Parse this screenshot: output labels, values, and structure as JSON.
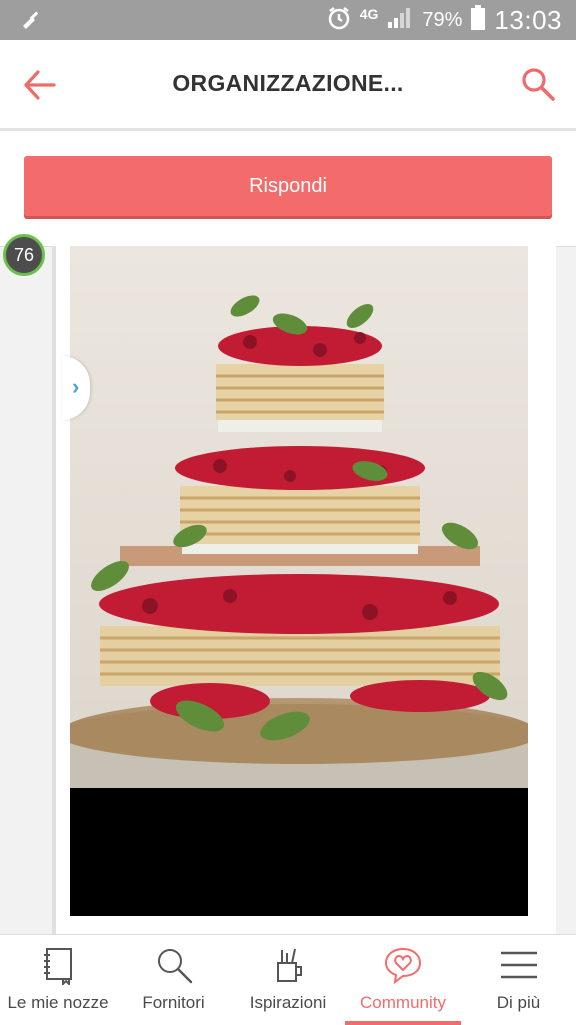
{
  "status_bar": {
    "network": "4G",
    "battery": "79%",
    "time": "13:03",
    "icons": [
      "cleaner-icon",
      "alarm-icon",
      "signal-icon",
      "battery-icon"
    ]
  },
  "app_bar": {
    "title": "ORGANIZZAZIONE...",
    "back_icon": "back-arrow-icon",
    "search_icon": "search-icon"
  },
  "reply_button": {
    "label": "Rispondi"
  },
  "post": {
    "score": "76",
    "image_desc_icon": "photo",
    "nav_arrow_icon": "chevron-right-icon"
  },
  "bottom_nav": {
    "items": [
      {
        "label": "Le mie nozze",
        "icon": "notebook-icon",
        "active": false
      },
      {
        "label": "Fornitori",
        "icon": "search-icon",
        "active": false
      },
      {
        "label": "Ispirazioni",
        "icon": "pencil-cup-icon",
        "active": false
      },
      {
        "label": "Community",
        "icon": "heart-chat-icon",
        "active": true
      },
      {
        "label": "Di più",
        "icon": "menu-icon",
        "active": false
      }
    ]
  },
  "colors": {
    "accent": "#f36b6b",
    "status_bar": "#9e9e9e",
    "score_ring": "#6cc04a"
  }
}
